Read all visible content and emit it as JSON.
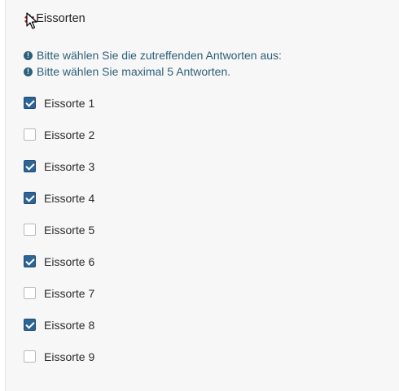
{
  "question": {
    "mandatory_marker": "✱",
    "title": "Eissorten"
  },
  "tips": [
    {
      "icon": "exclamation-circle-icon",
      "text": "Bitte wählen Sie die zutreffenden Antworten aus:"
    },
    {
      "icon": "exclamation-circle-icon",
      "text": "Bitte wählen Sie maximal 5 Antworten."
    }
  ],
  "options": [
    {
      "label": "Eissorte 1",
      "checked": true
    },
    {
      "label": "Eissorte 2",
      "checked": false
    },
    {
      "label": "Eissorte 3",
      "checked": true
    },
    {
      "label": "Eissorte 4",
      "checked": true
    },
    {
      "label": "Eissorte 5",
      "checked": false
    },
    {
      "label": "Eissorte 6",
      "checked": true
    },
    {
      "label": "Eissorte 7",
      "checked": false
    },
    {
      "label": "Eissorte 8",
      "checked": true
    },
    {
      "label": "Eissorte 9",
      "checked": false
    }
  ],
  "colors": {
    "mandatory": "#a6262c",
    "tip_text": "#2e5f79",
    "checkbox_checked": "#2d6596",
    "panel_background": "#f7f7f7"
  }
}
